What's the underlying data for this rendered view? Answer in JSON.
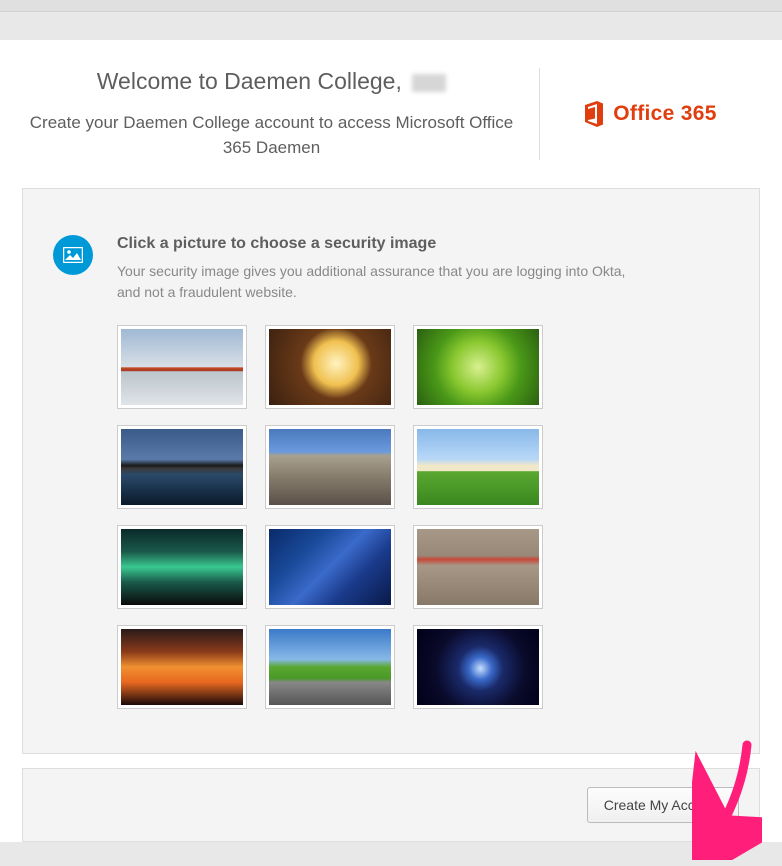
{
  "header": {
    "welcome_prefix": "Welcome to Daemen College,",
    "subtitle": "Create your Daemen College account to access Microsoft Office 365 Daemen",
    "brand_text": "Office 365",
    "brand_color": "#e03e0f"
  },
  "security": {
    "heading": "Click a picture to choose a security image",
    "description": "Your security image gives you additional assurance that you are logging into Okta, and not a fraudulent website.",
    "images": [
      {
        "name": "golden-gate-bridge"
      },
      {
        "name": "beverage-glass"
      },
      {
        "name": "green-succulent"
      },
      {
        "name": "harbour-bridge-night"
      },
      {
        "name": "brooklyn-bridge"
      },
      {
        "name": "sheep-field"
      },
      {
        "name": "aurora-borealis"
      },
      {
        "name": "circuit-board"
      },
      {
        "name": "toy-robot"
      },
      {
        "name": "fiery-sunset"
      },
      {
        "name": "open-road"
      },
      {
        "name": "manta-ray"
      }
    ]
  },
  "footer": {
    "create_label": "Create My Account"
  }
}
